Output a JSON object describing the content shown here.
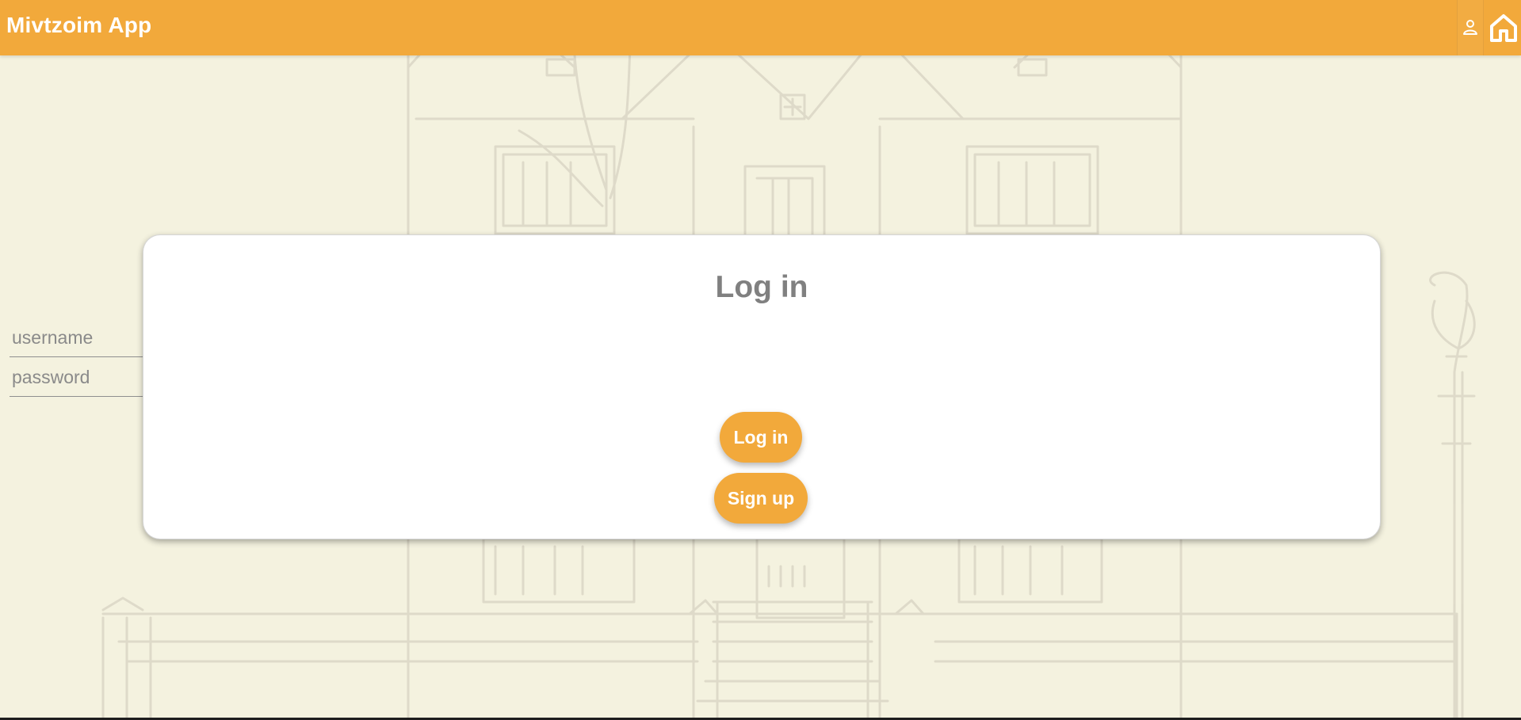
{
  "app": {
    "title": "Mivtzoim App"
  },
  "header": {
    "icons": [
      "user-icon",
      "home-icon"
    ]
  },
  "login_form": {
    "title": "Log in",
    "username": {
      "placeholder": "username",
      "value": ""
    },
    "password": {
      "placeholder": "password",
      "value": ""
    },
    "buttons": {
      "login": "Log in",
      "signup": "Sign up"
    }
  },
  "colors": {
    "header": "#f2a93b",
    "background": "#f4f2df",
    "button": "#f2a93b",
    "card": "#ffffff",
    "title": "#808080"
  }
}
